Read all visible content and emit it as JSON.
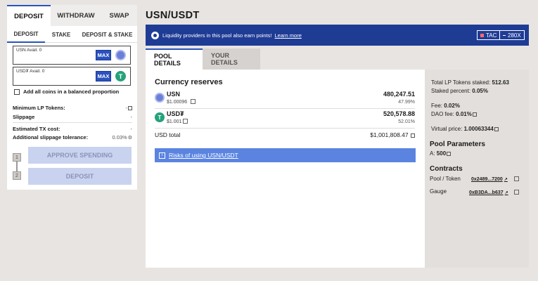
{
  "left": {
    "main_tabs": [
      "DEPOSIT",
      "WITHDRAW",
      "SWAP"
    ],
    "sub_tabs": [
      "DEPOSIT",
      "STAKE",
      "DEPOSIT & STAKE"
    ],
    "usn_label": "USN Avail. 0",
    "usdt_label": "USD₮ Avail. 0",
    "max_label": "MAX",
    "usdt_icon_glyph": "T",
    "balanced_label": "Add all coins in a balanced proportion",
    "min_lp_label": "Minimum LP Tokens:",
    "min_lp_value": "-",
    "slippage_label": "Slippage",
    "slippage_value": "-",
    "tx_cost_label": "Estimated TX cost:",
    "tx_cost_value": "-",
    "add_slip_label": "Additional slippage tolerance:",
    "add_slip_value": "0.03%",
    "step1": "1",
    "step2": "2",
    "approve_label": "APPROVE SPENDING",
    "deposit_label": "DEPOSIT"
  },
  "page_title": "USN/USDT",
  "banner": {
    "text": "Liquidity providers in this pool also earn points!",
    "link": "Learn more",
    "pill1": "TAC",
    "pill2": "280X"
  },
  "pool_tabs": [
    "POOL DETAILS",
    "YOUR DETAILS"
  ],
  "reserves": {
    "title": "Currency reserves",
    "coins": [
      {
        "name": "USN",
        "price": "$1.00096",
        "amount": "480,247.51",
        "pct": "47.99%"
      },
      {
        "name": "USD₮",
        "price": "$1.001",
        "amount": "520,578.88",
        "pct": "52.01%"
      }
    ],
    "total_label": "USD total",
    "total_value": "$1,001,808.47",
    "risk_label": "Risks of using USN/USDT",
    "risk_icon": "i"
  },
  "side": {
    "lp_staked_label": "Total LP Tokens staked:",
    "lp_staked_value": "512.63",
    "staked_pct_label": "Staked percent:",
    "staked_pct_value": "0.05%",
    "fee_label": "Fee:",
    "fee_value": "0.02%",
    "dao_fee_label": "DAO fee:",
    "dao_fee_value": "0.01%",
    "vprice_label": "Virtual price:",
    "vprice_value": "1.00063344",
    "params_title": "Pool Parameters",
    "a_label": "A:",
    "a_value": "500",
    "contracts_title": "Contracts",
    "pool_token_label": "Pool / Token",
    "pool_token_addr": "0x2489...7200",
    "gauge_label": "Gauge",
    "gauge_addr": "0xB3DA...b637"
  },
  "colors": {
    "accent": "#2a52be",
    "banner": "#1f3c95",
    "risk": "#5b84e0",
    "usdt": "#26a17b"
  }
}
